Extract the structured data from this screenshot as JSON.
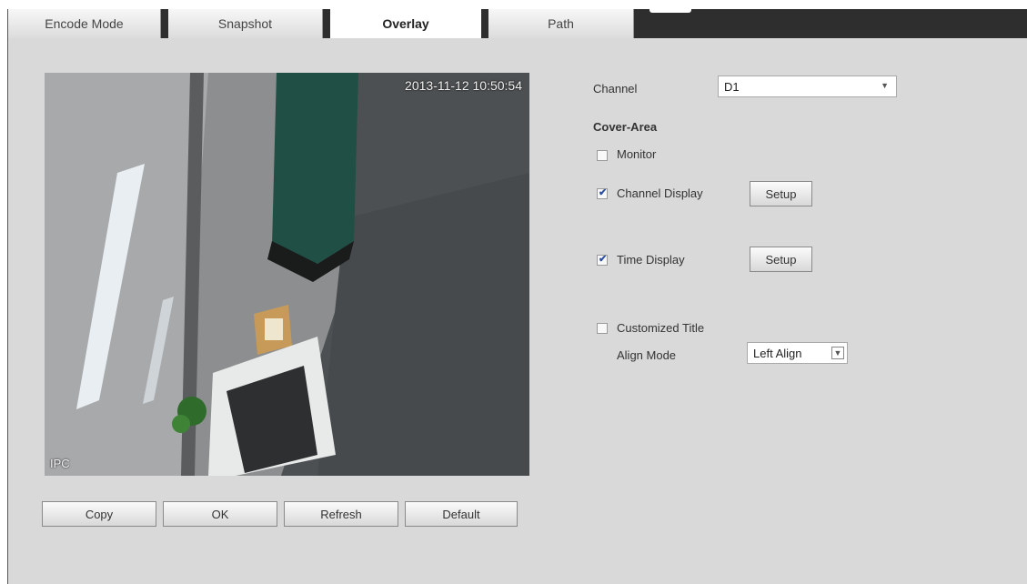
{
  "tabs": [
    {
      "label": "Encode Mode",
      "active": false
    },
    {
      "label": "Snapshot",
      "active": false
    },
    {
      "label": "Overlay",
      "active": true
    },
    {
      "label": "Path",
      "active": false
    }
  ],
  "preview": {
    "timestamp": "2013-11-12 10:50:54",
    "channel_label": "IPC"
  },
  "settings": {
    "channel": {
      "label": "Channel",
      "value": "D1"
    },
    "cover_area_heading": "Cover-Area",
    "monitor": {
      "label": "Monitor",
      "checked": false
    },
    "channel_display": {
      "label": "Channel Display",
      "checked": true,
      "setup_label": "Setup"
    },
    "time_display": {
      "label": "Time Display",
      "checked": true,
      "setup_label": "Setup"
    },
    "customized_title": {
      "label": "Customized Title",
      "checked": false
    },
    "align_mode": {
      "label": "Align Mode",
      "value": "Left Align"
    }
  },
  "actions": {
    "copy": "Copy",
    "ok": "OK",
    "refresh": "Refresh",
    "default": "Default"
  }
}
